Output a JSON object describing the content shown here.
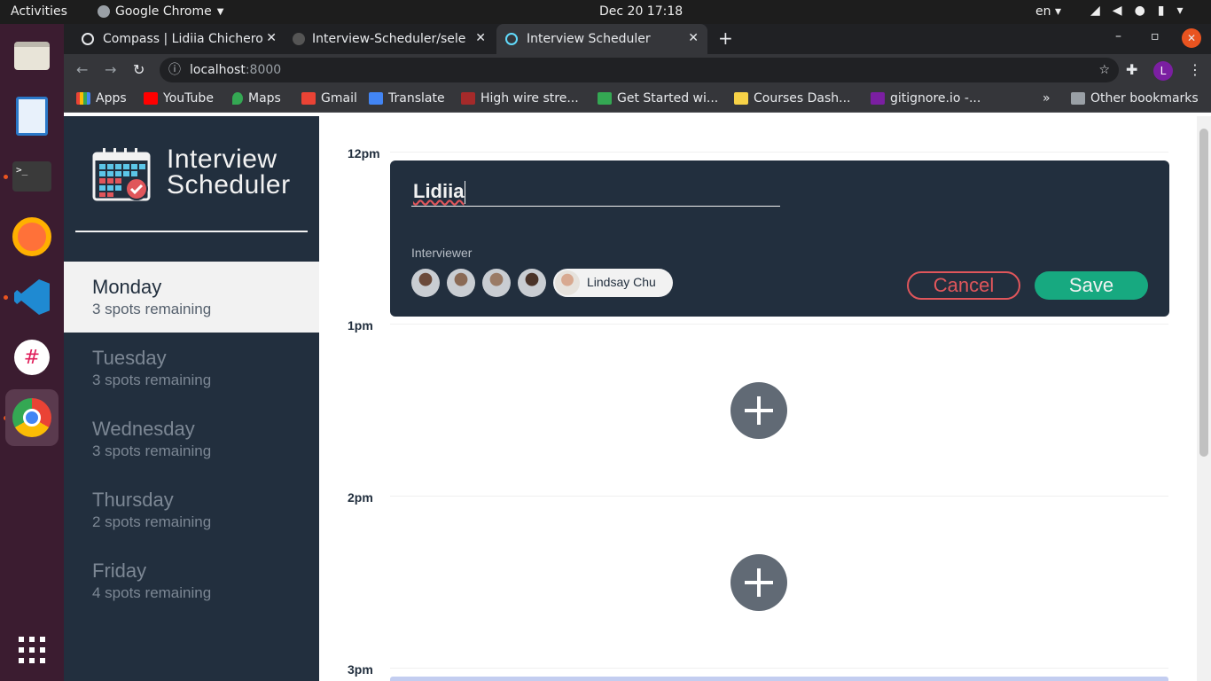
{
  "os": {
    "activities": "Activities",
    "app_menu": "Google Chrome",
    "clock": "Dec 20  17:18",
    "lang": "en"
  },
  "browser": {
    "tabs": [
      {
        "title": "Compass | Lidiia Chichero"
      },
      {
        "title": "Interview-Scheduler/sele"
      },
      {
        "title": "Interview Scheduler",
        "active": true
      }
    ],
    "url_host": "localhost",
    "url_port": ":8000",
    "bookmarks": [
      {
        "label": "Apps"
      },
      {
        "label": "YouTube"
      },
      {
        "label": "Maps"
      },
      {
        "label": "Gmail"
      },
      {
        "label": "Translate"
      },
      {
        "label": "High wire stre..."
      },
      {
        "label": "Get Started wi..."
      },
      {
        "label": "Courses Dash..."
      },
      {
        "label": "gitignore.io -..."
      }
    ],
    "other_bookmarks": "Other bookmarks",
    "profile_initial": "L"
  },
  "app": {
    "logo_line1": "Interview",
    "logo_line2": "Scheduler",
    "days": [
      {
        "name": "Monday",
        "spots": "3 spots remaining",
        "selected": true
      },
      {
        "name": "Tuesday",
        "spots": "3 spots remaining"
      },
      {
        "name": "Wednesday",
        "spots": "3 spots remaining"
      },
      {
        "name": "Thursday",
        "spots": "2 spots remaining"
      },
      {
        "name": "Friday",
        "spots": "4 spots remaining"
      }
    ],
    "hours": [
      "12pm",
      "1pm",
      "2pm",
      "3pm"
    ],
    "form": {
      "student_name": "Lidiia",
      "interviewer_label": "Interviewer",
      "selected_interviewer": "Lindsay Chu",
      "cancel": "Cancel",
      "save": "Save"
    }
  },
  "colors": {
    "sidebar_bg": "#222f3e",
    "save_green": "#17a980",
    "cancel_red": "#e0565b"
  }
}
